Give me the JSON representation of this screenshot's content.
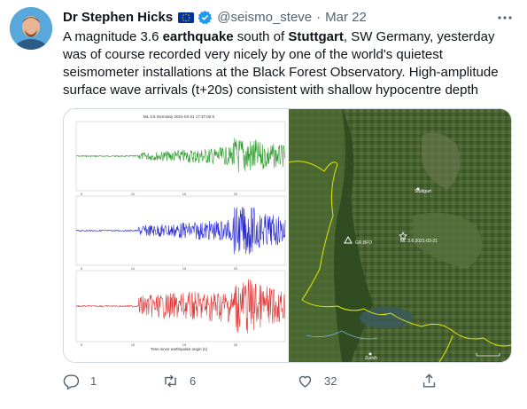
{
  "author": {
    "name": "Dr Stephen Hicks",
    "handle": "@seismo_steve",
    "separator": "·",
    "date": "Mar 22"
  },
  "tweet": {
    "seg1": "A magnitude 3.6 ",
    "bold1": "earthquake",
    "seg2": " south of ",
    "bold2": "Stuttgart",
    "seg3": ", SW Germany, yesterday was of course recorded very nicely by one of the world's quietest seismometer installations at the Black Forest Observatory. High-amplitude surface wave arrivals (t+20s) consistent with shallow hypocentre depth"
  },
  "seismogram": {
    "title": "ML 3.6 Germany 2021-03-21 17:37:02.5",
    "xlabel": "Time since earthquake origin (s)",
    "ticks": [
      "5",
      "10",
      "15",
      "20"
    ],
    "colors": [
      "#2e9a2e",
      "#2a2ad0",
      "#e03a3a"
    ]
  },
  "map": {
    "label_stuttgart": "Stuttgart",
    "label_station": "GR.BFO",
    "label_event": "ML 3.6 2021-03-21",
    "label_zurich": "Zurich"
  },
  "actions": {
    "reply_count": "1",
    "retweet_count": "6",
    "like_count": "32"
  },
  "colors": {
    "text": "#0f1419",
    "secondary": "#536471",
    "verified": "#1d9bf0",
    "eu_flag": "#003399"
  }
}
